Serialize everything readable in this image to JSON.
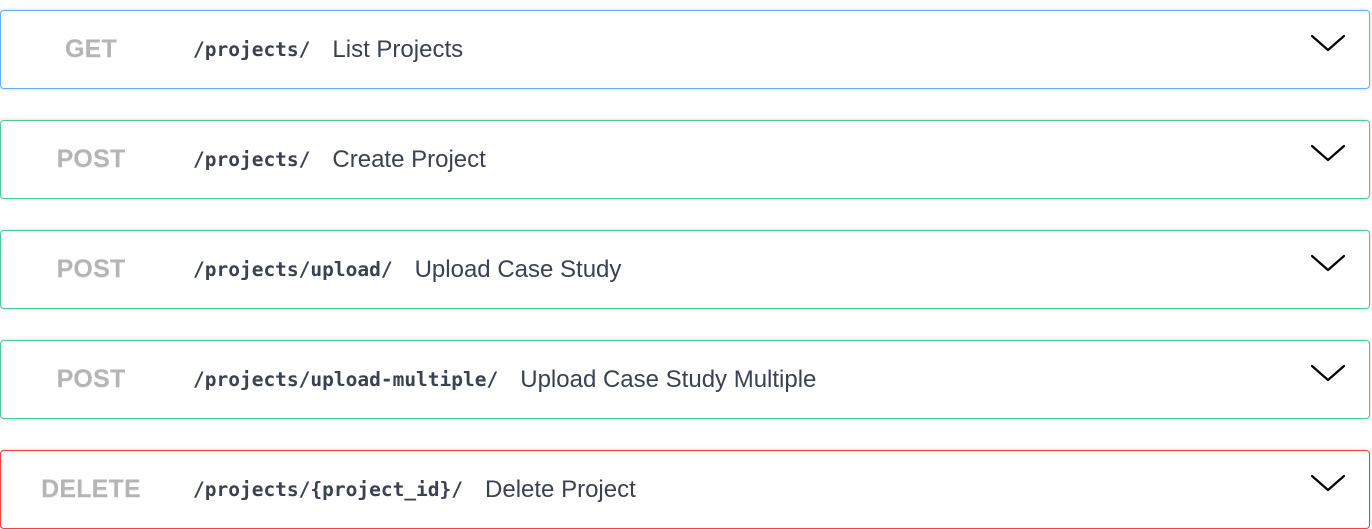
{
  "operations": [
    {
      "method": "GET",
      "path": "/projects/",
      "summary": "List Projects",
      "expand_icon": "chevron-down-icon"
    },
    {
      "method": "POST",
      "path": "/projects/",
      "summary": "Create Project",
      "expand_icon": "chevron-down-icon"
    },
    {
      "method": "POST",
      "path": "/projects/upload/",
      "summary": "Upload Case Study",
      "expand_icon": "chevron-down-icon"
    },
    {
      "method": "POST",
      "path": "/projects/upload-multiple/",
      "summary": "Upload Case Study Multiple",
      "expand_icon": "chevron-down-icon"
    },
    {
      "method": "DELETE",
      "path": "/projects/{project_id}/",
      "summary": "Delete Project",
      "expand_icon": "chevron-down-icon"
    }
  ],
  "colors": {
    "get_border": "#61affe",
    "post_border": "#49cc90",
    "delete_border": "#f93e3e",
    "method_text": "#b5b5b5",
    "text": "#3b4151"
  }
}
